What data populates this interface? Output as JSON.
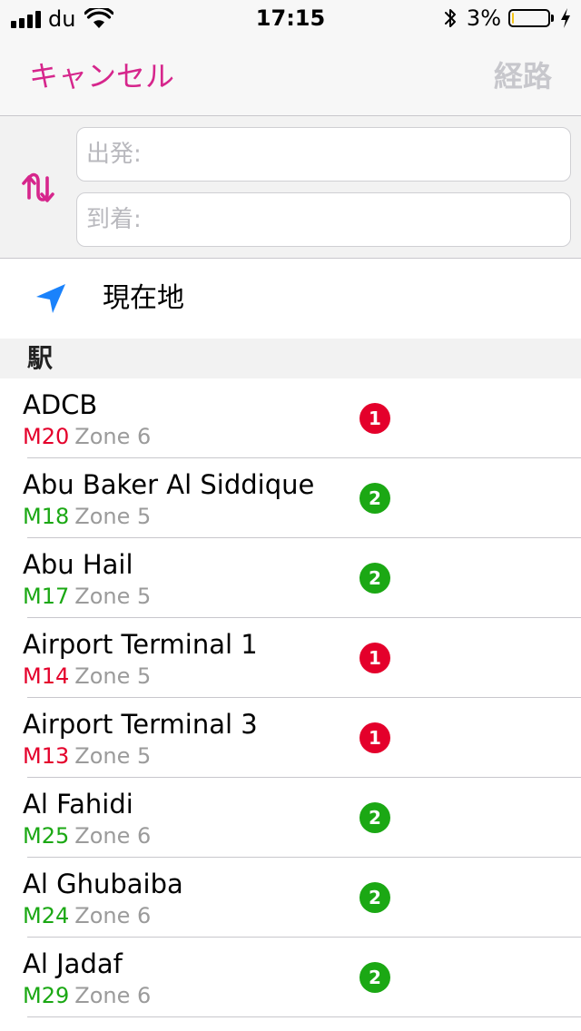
{
  "status_bar": {
    "carrier": "du",
    "time": "17:15",
    "battery_percent": "3%",
    "battery_level": 0.06,
    "battery_color": "#f5c518"
  },
  "nav": {
    "cancel_label": "キャンセル",
    "route_label": "経路"
  },
  "route": {
    "swap_icon": "swap-vertical-icon",
    "from_placeholder": "出発:",
    "to_placeholder": "到着:"
  },
  "current_location": {
    "icon": "location-arrow-icon",
    "label": "現在地"
  },
  "section": {
    "title": "駅"
  },
  "colors": {
    "accent": "#d6268c",
    "red_line": "#e4002b",
    "green_line": "#1ba814",
    "location_blue": "#1a82fb"
  },
  "stations": [
    {
      "name": "ADCB",
      "code": "M20",
      "zone": "Zone 6",
      "line": "1",
      "line_color": "#e4002b"
    },
    {
      "name": "Abu Baker Al Siddique",
      "code": "M18",
      "zone": "Zone 5",
      "line": "2",
      "line_color": "#1ba814"
    },
    {
      "name": "Abu Hail",
      "code": "M17",
      "zone": "Zone 5",
      "line": "2",
      "line_color": "#1ba814"
    },
    {
      "name": "Airport Terminal 1",
      "code": "M14",
      "zone": "Zone 5",
      "line": "1",
      "line_color": "#e4002b"
    },
    {
      "name": "Airport Terminal 3",
      "code": "M13",
      "zone": "Zone 5",
      "line": "1",
      "line_color": "#e4002b"
    },
    {
      "name": "Al Fahidi",
      "code": "M25",
      "zone": "Zone 6",
      "line": "2",
      "line_color": "#1ba814"
    },
    {
      "name": "Al Ghubaiba",
      "code": "M24",
      "zone": "Zone 6",
      "line": "2",
      "line_color": "#1ba814"
    },
    {
      "name": "Al Jadaf",
      "code": "M29",
      "zone": "Zone 6",
      "line": "2",
      "line_color": "#1ba814"
    }
  ]
}
